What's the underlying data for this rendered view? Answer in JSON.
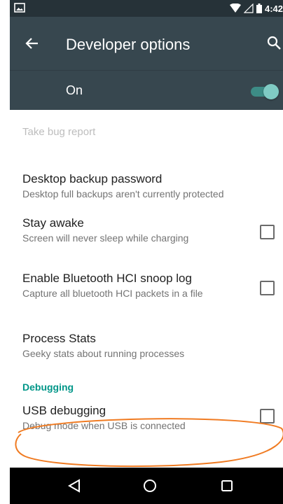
{
  "status_bar": {
    "time": "4:42",
    "icons": [
      "image-icon",
      "wifi-icon",
      "signal-icon",
      "battery-icon"
    ]
  },
  "toolbar": {
    "title": "Developer options",
    "back_icon": "arrow-back-icon",
    "search_icon": "search-icon"
  },
  "master_switch": {
    "label": "On",
    "checked": true,
    "accent": "#80cbc4"
  },
  "settings": {
    "bug_report": {
      "title": "Take bug report"
    },
    "backup_password": {
      "title": "Desktop backup password",
      "summary": "Desktop full backups aren't currently protected"
    },
    "stay_awake": {
      "title": "Stay awake",
      "summary": "Screen will never sleep while charging",
      "checked": false
    },
    "bt_snoop": {
      "title": "Enable Bluetooth HCI snoop log",
      "summary": "Capture all bluetooth HCI packets in a file",
      "checked": false
    },
    "process_stats": {
      "title": "Process Stats",
      "summary": "Geeky stats about running processes"
    },
    "debugging_header": "Debugging",
    "usb_debugging": {
      "title": "USB debugging",
      "summary": "Debug mode when USB is connected",
      "checked": false
    }
  },
  "annotation": {
    "color": "#f07b22"
  },
  "nav_bar": {
    "back": "triangle-back-icon",
    "home": "circle-home-icon",
    "recents": "square-recents-icon"
  },
  "colors": {
    "status_bar": "#263238",
    "toolbar": "#37474f",
    "section_accent": "#009688"
  }
}
